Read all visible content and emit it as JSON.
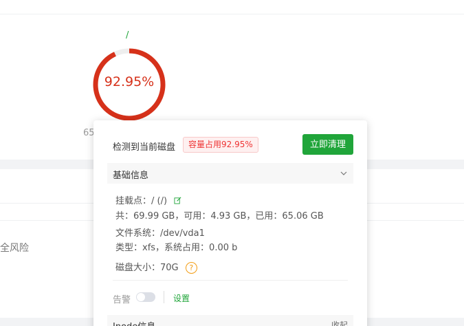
{
  "disk": {
    "mount_path": "/",
    "usage_percent_text": "92.95%",
    "usage_fraction": 0.9295,
    "under_gauge_text": "65"
  },
  "background": {
    "risk_text": "全风险"
  },
  "popup": {
    "title": "检测到当前磁盘",
    "badge": "容量占用92.95%",
    "clean_button": "立即清理",
    "basic_section": {
      "title": "基础信息",
      "mount_label": "挂载点：/ (/)",
      "capacity_line": "共：69.99 GB，可用：4.93 GB，已用：65.06 GB",
      "fs_line": "文件系统：/dev/vda1",
      "type_line": "类型：xfs，系统占用：0.00 b",
      "size_line": "磁盘大小：70G"
    },
    "alert_label": "告警",
    "settings_link": "设置",
    "inode_section": {
      "title": "Inode信息",
      "toggle_label": "收起"
    }
  },
  "colors": {
    "accent": "#20a53a",
    "danger": "#d6311a",
    "warning": "#f39c12"
  }
}
